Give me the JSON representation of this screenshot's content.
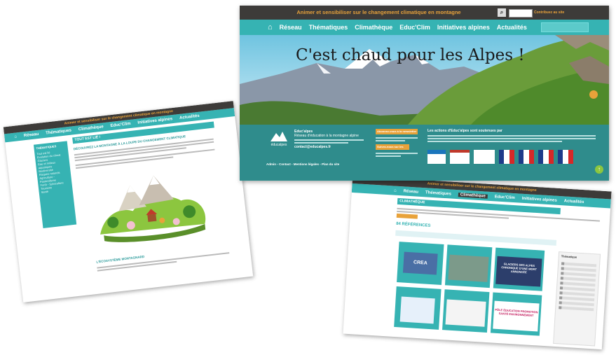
{
  "colors": {
    "teal": "#36b3b3",
    "dark": "#3d3b39",
    "orange": "#e8a23a",
    "sky": "#5fc6d6"
  },
  "top_shot": {
    "header_title": "Animer et sensibiliser sur le changement climatique en montagne",
    "search_icon": "search-icon",
    "contribute": "Contribuez au site",
    "nav": [
      "Réseau",
      "Thématiques",
      "Climathèque",
      "Educ'Clim",
      "Initiatives alpines",
      "Actualités"
    ],
    "home_icon": "home-icon",
    "hero_title": "C'est chaud pour les Alpes !",
    "footer": {
      "logo_text": "éducalpes",
      "org_name": "Educ'alpes",
      "org_desc": "Réseau d'éducation à la montagne alpine",
      "email": "contact@educalpes.fr",
      "links": "Admin - Contact - Mentions légales - Plan du site",
      "btn_newsletter": "Abonnez-vous à la newsletter",
      "btn_social": "Suivez-nous sur les réseaux",
      "partners_intro": "Les actions d'Educ'alpes sont soutenues par",
      "up_icon": "arrow-up-icon"
    }
  },
  "left_shot": {
    "header_title": "Animer et sensibiliser sur le changement climatique en montagne",
    "nav": [
      "Réseau",
      "Thématiques",
      "Climathèque",
      "Educ'Clim",
      "Initiatives alpines",
      "Actualités"
    ],
    "page_title": "TOUT EST LIÉ !",
    "sidebar_title": "THÉMATIQUES",
    "sidebar_items": [
      "Tout est lié",
      "Evolution du climat",
      "Glaciers",
      "Eau et milieux aquatiques",
      "Biodiversité",
      "Risques naturels",
      "Agriculture - Pastoralisme",
      "Forêt - Sylviculture",
      "Tourisme",
      "Santé"
    ],
    "section_heading": "DÉCOUVREZ LA MONTAGNE À LA LOUPE DU CHANGEMENT CLIMATIQUE",
    "bottom_heading": "L'ÉCOSYSTÈME MONTAGNARD"
  },
  "right_shot": {
    "header_title": "Animer et sensibiliser sur le changement climatique en montagne",
    "nav": [
      "Réseau",
      "Thématiques",
      "Climathèque",
      "Educ'Clim",
      "Initiatives alpines",
      "Actualités"
    ],
    "page_title": "CLIMATHÈQUE",
    "results_title": "84 RÉFÉRENCES",
    "sidebar_title": "Thématique",
    "cards": [
      "CREA",
      "GLACIERS DES ALPES CHRONIQUE D'UNE MORT ANNONCÉE",
      "PÔLE ÉDUCATION PROMOTION SANTÉ ENVIRONNEMENT"
    ]
  }
}
